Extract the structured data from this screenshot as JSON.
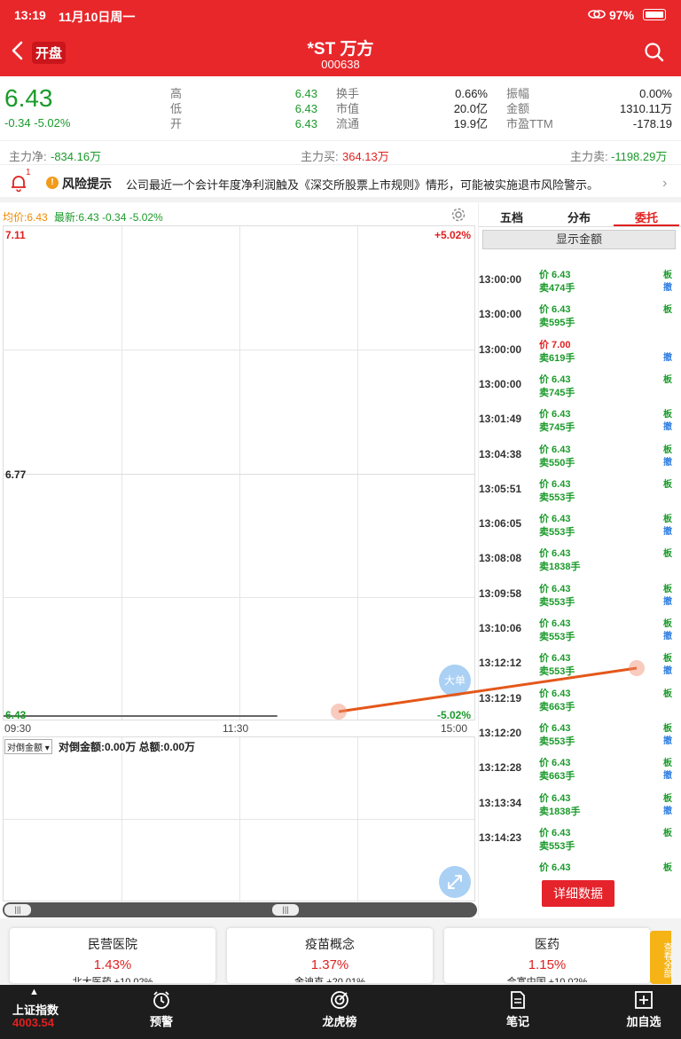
{
  "status": {
    "time": "13:19",
    "date": "11月10日周一",
    "battery": "97%"
  },
  "header": {
    "back_badge": "开盘",
    "title": "*ST 万方",
    "code": "000638"
  },
  "quote": {
    "price": "6.43",
    "change": "-0.34 -5.02%",
    "col1": [
      {
        "label": "高",
        "value": "6.43"
      },
      {
        "label": "低",
        "value": "6.43"
      },
      {
        "label": "开",
        "value": "6.43"
      }
    ],
    "col2": [
      {
        "label": "换手",
        "value": "0.66%"
      },
      {
        "label": "市值",
        "value": "20.0亿"
      },
      {
        "label": "流通",
        "value": "19.9亿"
      }
    ],
    "col3": [
      {
        "label": "振幅",
        "value": "0.00%"
      },
      {
        "label": "金额",
        "value": "1310.11万"
      },
      {
        "label": "市盈TTM",
        "value": "-178.19"
      }
    ]
  },
  "flow": {
    "net_label": "主力净:",
    "net_value": "-834.16万",
    "buy_label": "主力买:",
    "buy_value": "364.13万",
    "sell_label": "主力卖:",
    "sell_value": "-1198.29万"
  },
  "risk": {
    "badge": "1",
    "title": "风险提示",
    "text": "公司最近一个会计年度净利润触及《深交所股票上市规则》情形，可能被实施退市风险警示。"
  },
  "chart_info": {
    "avg_label": "均价:6.43",
    "latest_label": "最新:6.43 -0.34 -5.02%"
  },
  "chart_data": {
    "type": "line",
    "x_ticks": [
      "09:30",
      "11:30",
      "15:00"
    ],
    "y_ticks_left": [
      "7.11",
      "6.77",
      "6.43"
    ],
    "y_ticks_right": [
      "+5.02%",
      "-5.02%"
    ],
    "ylim": [
      6.43,
      7.11
    ],
    "series": [
      {
        "x": [
          "09:30",
          "13:19"
        ],
        "values": [
          6.43,
          6.43
        ]
      }
    ]
  },
  "big_order_label": "大单",
  "sub_chart": {
    "selector": "对倒金额",
    "text": "对倒金额:0.00万 总额:0.00万"
  },
  "tabs": [
    "五档",
    "分布",
    "委托"
  ],
  "show_amount_btn": "显示金额",
  "orders": [
    {
      "time": "13:00:00",
      "price": "价 6.43",
      "vol": "卖474手",
      "tag1": "板",
      "tag2": "撤",
      "price_color": "#1a9a2a"
    },
    {
      "time": "13:00:00",
      "price": "价 6.43",
      "vol": "卖595手",
      "tag1": "板",
      "tag2": "",
      "price_color": "#1a9a2a"
    },
    {
      "time": "13:00:00",
      "price": "价 7.00",
      "vol": "卖619手",
      "tag1": "",
      "tag2": "撤",
      "price_color": "#e02020"
    },
    {
      "time": "13:00:00",
      "price": "价 6.43",
      "vol": "卖745手",
      "tag1": "板",
      "tag2": "",
      "price_color": "#1a9a2a"
    },
    {
      "time": "13:01:49",
      "price": "价 6.43",
      "vol": "卖745手",
      "tag1": "板",
      "tag2": "撤",
      "price_color": "#1a9a2a"
    },
    {
      "time": "13:04:38",
      "price": "价 6.43",
      "vol": "卖550手",
      "tag1": "板",
      "tag2": "撤",
      "price_color": "#1a9a2a"
    },
    {
      "time": "13:05:51",
      "price": "价 6.43",
      "vol": "卖553手",
      "tag1": "板",
      "tag2": "",
      "price_color": "#1a9a2a"
    },
    {
      "time": "13:06:05",
      "price": "价 6.43",
      "vol": "卖553手",
      "tag1": "板",
      "tag2": "撤",
      "price_color": "#1a9a2a"
    },
    {
      "time": "13:08:08",
      "price": "价 6.43",
      "vol": "卖1838手",
      "tag1": "板",
      "tag2": "",
      "price_color": "#1a9a2a"
    },
    {
      "time": "13:09:58",
      "price": "价 6.43",
      "vol": "卖553手",
      "tag1": "板",
      "tag2": "撤",
      "price_color": "#1a9a2a"
    },
    {
      "time": "13:10:06",
      "price": "价 6.43",
      "vol": "卖553手",
      "tag1": "板",
      "tag2": "撤",
      "price_color": "#1a9a2a"
    },
    {
      "time": "13:12:12",
      "price": "价 6.43",
      "vol": "卖553手",
      "tag1": "板",
      "tag2": "撤",
      "price_color": "#1a9a2a"
    },
    {
      "time": "13:12:19",
      "price": "价 6.43",
      "vol": "卖663手",
      "tag1": "板",
      "tag2": "",
      "price_color": "#1a9a2a"
    },
    {
      "time": "13:12:20",
      "price": "价 6.43",
      "vol": "卖553手",
      "tag1": "板",
      "tag2": "撤",
      "price_color": "#1a9a2a"
    },
    {
      "time": "13:12:28",
      "price": "价 6.43",
      "vol": "卖663手",
      "tag1": "板",
      "tag2": "撤",
      "price_color": "#1a9a2a"
    },
    {
      "time": "13:13:34",
      "price": "价 6.43",
      "vol": "卖1838手",
      "tag1": "板",
      "tag2": "撤",
      "price_color": "#1a9a2a"
    },
    {
      "time": "13:14:23",
      "price": "价 6.43",
      "vol": "卖553手",
      "tag1": "板",
      "tag2": "",
      "price_color": "#1a9a2a"
    },
    {
      "time": "",
      "price": "价 6.43",
      "vol": "",
      "tag1": "板",
      "tag2": "",
      "price_color": "#1a9a2a"
    }
  ],
  "detail_btn": "详细数据",
  "sectors": [
    {
      "name": "民营医院",
      "pct": "1.43%",
      "lead": "北大医药 +10.02%"
    },
    {
      "name": "疫苗概念",
      "pct": "1.37%",
      "lead": "金迪克 +20.01%"
    },
    {
      "name": "医药",
      "pct": "1.15%",
      "lead": "合富中国 +10.02%"
    }
  ],
  "view_all": "查看全部",
  "nav": {
    "index_name": "上证指数",
    "index_value": "4003.54",
    "items": [
      "预警",
      "龙虎榜",
      "笔记",
      "加自选"
    ]
  },
  "colors": {
    "brand": "#e8272b",
    "up": "#e02020",
    "down": "#1a9a2a",
    "annotation": "#e4571a"
  }
}
